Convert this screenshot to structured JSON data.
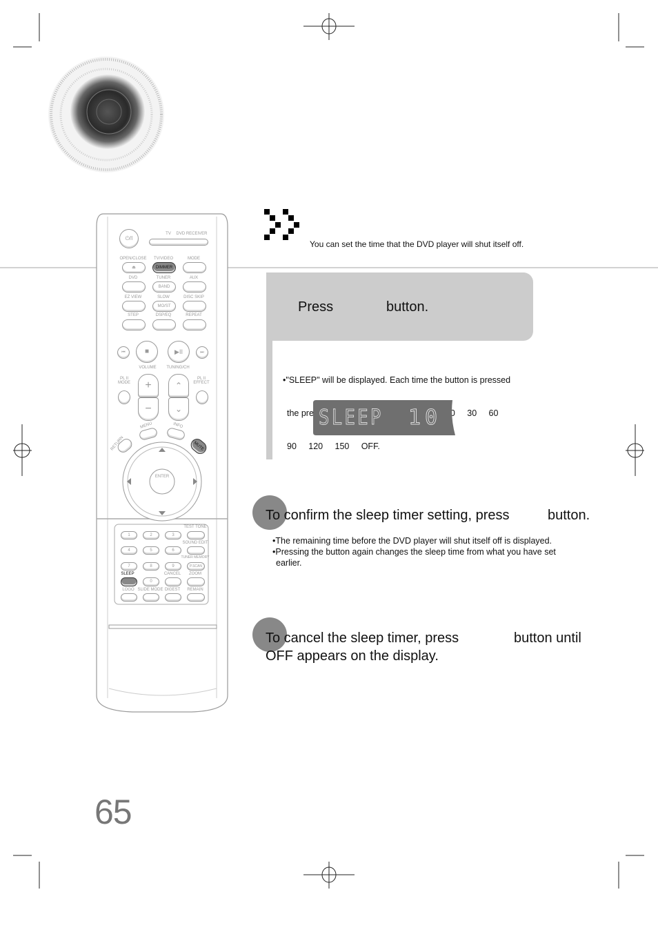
{
  "page": {
    "number": "65"
  },
  "header": {
    "icon": "double-chevron-icon",
    "subtitle": "You can set the time that the DVD player will shut itself off."
  },
  "step1": {
    "press_label": "Press",
    "button_label": "button.",
    "note_line1": "•\"SLEEP\" will be displayed. Each time the button is pressed",
    "note_line2": "the preset time changes as follows: 10     20     30     60",
    "note_line3": "90     120     150     OFF.",
    "preset_times": [
      "10",
      "20",
      "30",
      "60",
      "90",
      "120",
      "150",
      "OFF"
    ],
    "display": {
      "text": "SLEEP",
      "value": "10"
    }
  },
  "step2": {
    "text_before": "To confirm the sleep timer setting, press",
    "text_after": "button.",
    "notes": [
      "•The remaining time before the DVD player will shut itself off is displayed.",
      "•Pressing the button again changes the sleep time from what you have set",
      "earlier."
    ]
  },
  "step3": {
    "text_before": "To cancel the sleep timer, press",
    "text_after": "button until",
    "line2": "OFF appears on the display."
  },
  "remote": {
    "power": "⏻/I",
    "tv": "TV",
    "dvd_receiver": "DVD RECEIVER",
    "row1": [
      "OPEN/CLOSE",
      "TV/VIDEO",
      "MODE"
    ],
    "dimmer": "DIMMER",
    "eject": "⏏",
    "row2": [
      "DVD",
      "TUNER",
      "AUX"
    ],
    "band": "BAND",
    "row3": [
      "EZ VIEW",
      "SLOW",
      "DISC SKIP"
    ],
    "most": "MO/ST",
    "row4": [
      "STEP",
      "DSP/EQ",
      "REPEAT"
    ],
    "volume": "VOLUME",
    "tuning": "TUNING/CH",
    "pl_mode": "PL II MODE",
    "pl_effect": "PL II EFFECT",
    "menu": "MENU",
    "info": "INFO",
    "return": "RETURN",
    "mute": "MUTE",
    "enter": "ENTER",
    "numbers": [
      "1",
      "2",
      "3",
      "4",
      "5",
      "6",
      "7",
      "8",
      "9",
      "0"
    ],
    "test_tone": "TEST TONE",
    "sound_edit": "SOUND EDIT",
    "tuner_memory": "TUNER MEMORY",
    "pscan": "P.SCAN",
    "sleep": "SLEEP",
    "cancel": "CANCEL",
    "zoom": "ZOOM",
    "logo": "LOGO",
    "slide_mode": "SLIDE MODE",
    "digest": "DIGEST",
    "remain": "REMAIN"
  }
}
